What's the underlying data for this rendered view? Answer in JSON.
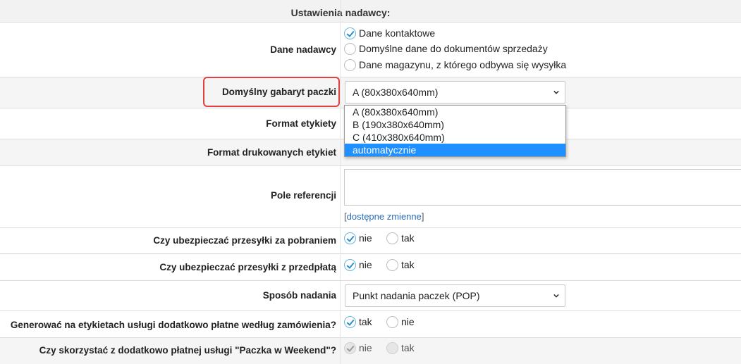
{
  "header": {
    "title": "Ustawienia nadawcy:"
  },
  "sender_data": {
    "label": "Dane nadawcy",
    "options": [
      {
        "label": "Dane kontaktowe",
        "checked": true
      },
      {
        "label": "Domyślne dane do dokumentów sprzedaży",
        "checked": false
      },
      {
        "label": "Dane magazynu, z którego odbywa się wysyłka",
        "checked": false
      }
    ]
  },
  "package_size": {
    "label": "Domyślny gabaryt paczki",
    "selected": "A (80x380x640mm)",
    "dropdown_open": true,
    "options": [
      "A (80x380x640mm)",
      "B (190x380x640mm)",
      "C (410x380x640mm)",
      "automatycznie"
    ],
    "highlighted_option": "automatycznie"
  },
  "label_format": {
    "label": "Format etykiety"
  },
  "print_format": {
    "label": "Format drukowanych etykiet"
  },
  "reference": {
    "label": "Pole referencji",
    "value": "",
    "link_open": "[",
    "link_text": "dostępne zmienne",
    "link_close": "]"
  },
  "insure_cod": {
    "label": "Czy ubezpieczać przesyłki za pobraniem",
    "options": [
      {
        "label": "nie",
        "checked": true
      },
      {
        "label": "tak",
        "checked": false
      }
    ]
  },
  "insure_prepaid": {
    "label": "Czy ubezpieczać przesyłki z przedpłatą",
    "options": [
      {
        "label": "nie",
        "checked": true
      },
      {
        "label": "tak",
        "checked": false
      }
    ]
  },
  "dispatch_method": {
    "label": "Sposób nadania",
    "selected": "Punkt nadania paczek (POP)"
  },
  "extra_services": {
    "label": "Generować na etykietach usługi dodatkowo płatne według zamówienia?",
    "options": [
      {
        "label": "tak",
        "checked": true
      },
      {
        "label": "nie",
        "checked": false
      }
    ]
  },
  "weekend_package": {
    "label": "Czy skorzystać z dodatkowo płatnej usługi \"Paczka w Weekend\"?",
    "disabled": true,
    "options": [
      {
        "label": "nie",
        "checked": true
      },
      {
        "label": "tak",
        "checked": false
      }
    ]
  },
  "colors": {
    "accent": "#2f8fc9",
    "selected_option": "#1e90ff",
    "highlight_border": "#e34040",
    "link": "#2a6ebb"
  },
  "icons": {
    "radio_checked": "checkmark-icon",
    "select_arrow": "chevron-down-icon"
  }
}
